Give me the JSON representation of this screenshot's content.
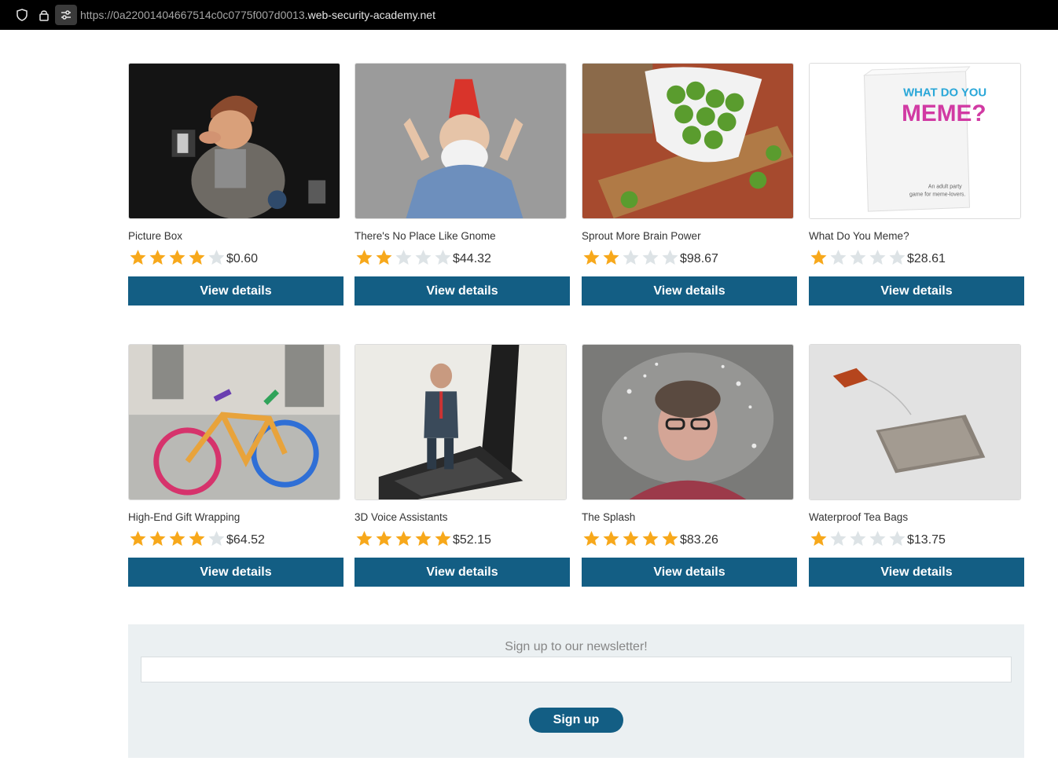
{
  "browser": {
    "url_scheme": "https://",
    "url_subdomain": "0a22001404667514c0c0775f007d0013",
    "url_domain": ".web-security-academy.net",
    "icons": [
      "shield-icon",
      "lock-icon",
      "permissions-icon"
    ]
  },
  "colors": {
    "button": "#135e84",
    "star_filled": "#f7a81b",
    "star_empty": "#dde3e6",
    "newsletter_bg": "#ebf0f2"
  },
  "products": [
    {
      "title": "Picture Box",
      "rating": 4,
      "max_rating": 5,
      "price": "$0.60",
      "button": "View details",
      "image": "photographer-figurine"
    },
    {
      "title": "There's No Place Like Gnome",
      "rating": 2,
      "max_rating": 5,
      "price": "$44.32",
      "button": "View details",
      "image": "gnome-costume"
    },
    {
      "title": "Sprout More Brain Power",
      "rating": 2,
      "max_rating": 5,
      "price": "$98.67",
      "button": "View details",
      "image": "brussels-sprouts"
    },
    {
      "title": "What Do You Meme?",
      "rating": 1,
      "max_rating": 5,
      "price": "$28.61",
      "button": "View details",
      "image": "card-game-box"
    },
    {
      "title": "High-End Gift Wrapping",
      "rating": 4,
      "max_rating": 5,
      "price": "$64.52",
      "button": "View details",
      "image": "knitted-bicycle"
    },
    {
      "title": "3D Voice Assistants",
      "rating": 5,
      "max_rating": 5,
      "price": "$52.15",
      "button": "View details",
      "image": "figure-on-phone"
    },
    {
      "title": "The Splash",
      "rating": 5,
      "max_rating": 5,
      "price": "$83.26",
      "button": "View details",
      "image": "water-splash-face"
    },
    {
      "title": "Waterproof Tea Bags",
      "rating": 1,
      "max_rating": 5,
      "price": "$13.75",
      "button": "View details",
      "image": "tea-bag"
    }
  ],
  "box_text": {
    "line1": "WHAT DO YOU",
    "line2": "MEME?",
    "line3": "An adult party",
    "line4": "game for meme-lovers."
  },
  "newsletter": {
    "title": "Sign up to our newsletter!",
    "input_value": "",
    "button": "Sign up"
  }
}
